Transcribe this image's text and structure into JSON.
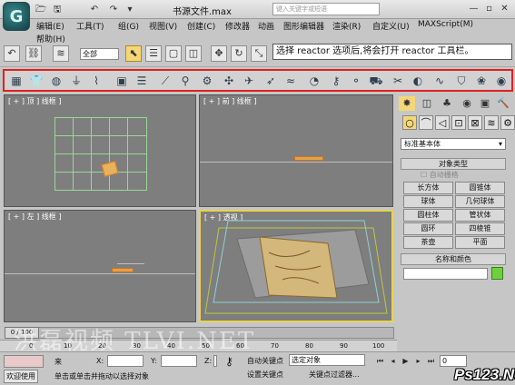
{
  "window": {
    "title": "书源文件.max",
    "help_search_placeholder": "键入关键字或短语",
    "app_logo": "G",
    "quick_access": [
      "🗁",
      "🖫",
      "↶",
      "↷",
      "▾"
    ],
    "window_buttons": [
      "—",
      "▫",
      "✕"
    ]
  },
  "menu": {
    "row1": [
      "编辑(E)",
      "工具(T)",
      "组(G)",
      "视图(V)",
      "创建(C)",
      "修改器",
      "动画",
      "图形编辑器",
      "渲染(R)",
      "自定义(U)",
      "MAXScript(M)"
    ],
    "row2": [
      "帮助(H)"
    ]
  },
  "main_toolbar": {
    "select_filter": "全部",
    "tooltip": "选择 reactor 选项后,将会打开 reactor 工具栏。"
  },
  "reactor_toolbar": {
    "icons": [
      "collection-icon",
      "cloth-icon",
      "ball-icon",
      "plane-icon",
      "spring-icon",
      "box-icon",
      "stack-icon",
      "rod-icon",
      "wrench-icon",
      "gear-icon",
      "fan-icon",
      "plane-jet-icon",
      "bird-icon",
      "wave-icon",
      "water-icon",
      "hinge-icon",
      "point-icon",
      "car-icon",
      "key-icon",
      "pendulum-icon",
      "rope-icon",
      "shirt-icon",
      "wind-icon",
      "toy-icon",
      "globe-icon"
    ]
  },
  "viewports": {
    "top": "[ + ] 顶 ] 线框 ]",
    "front": "[ + ] 前 ] 线框 ]",
    "left": "[ + ] 左 ] 线框 ]",
    "perspective": "[ + ] 透视 ]"
  },
  "command_panel": {
    "dropdown_value": "标准基本体",
    "object_type_header": "对象类型",
    "autogrid_label": "自动栅格",
    "object_buttons": [
      "长方体",
      "圆锥体",
      "球体",
      "几何球体",
      "圆柱体",
      "管状体",
      "圆环",
      "四棱锥",
      "茶壶",
      "平面"
    ],
    "name_color_header": "名称和颜色",
    "color_swatch": "#6fcf3f"
  },
  "timeline": {
    "frame_display": "0 / 100",
    "ticks": [
      "0",
      "10",
      "20",
      "30",
      "40",
      "50",
      "60",
      "70",
      "80",
      "90",
      "100"
    ]
  },
  "status": {
    "welcome": "欢迎使用",
    "prompt": "单击或单击并拖动以选择对象",
    "x_label": "X:",
    "y_label": "Y:",
    "z_label": "Z:",
    "auto_key": "自动关键点",
    "set_key": "设置关键点",
    "selected_object": "选定对象",
    "key_filters": "关键点过滤器...",
    "frame": "0",
    "extra_prefix": "来"
  },
  "overlay": {
    "watermark": "洪磊视频 TLVI.NET",
    "brand": "Ps123.Net"
  },
  "colors": {
    "reactor_highlight": "#e02020",
    "active_viewport_border": "#e9d44a"
  }
}
